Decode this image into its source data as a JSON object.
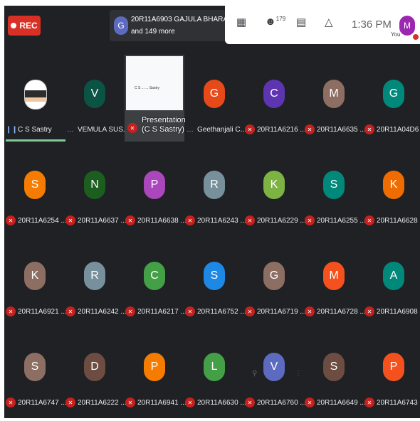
{
  "recording": {
    "label": "REC"
  },
  "presenter_chip": {
    "avatar": "G",
    "line1": "20R11A6903 GAJULA BHARAD...",
    "line2": "and 149 more"
  },
  "controls": {
    "participants_count": "179",
    "time": "1:36 PM",
    "self_avatar": "M",
    "self_label": "You"
  },
  "presentation": {
    "label_line1": "Presentation",
    "label_line2": "(C S Sastry)",
    "slide_text": "C S ...  ... Sastry"
  },
  "tiles": [
    {
      "initial": "",
      "name": "C S Sastry",
      "color": "#ffffff",
      "state": "speaking",
      "photo": true
    },
    {
      "initial": "V",
      "name": "VEMULA SUS...",
      "color": "#0b5345",
      "state": "dots"
    },
    {
      "initial": "G",
      "name": "Geethanjali C...",
      "color": "#e64a19",
      "state": "dots"
    },
    {
      "initial": "C",
      "name": "20R11A6216 ...",
      "color": "#5e35b1",
      "state": "muted"
    },
    {
      "initial": "M",
      "name": "20R11A6635 ...",
      "color": "#8d6e63",
      "state": "muted"
    },
    {
      "initial": "G",
      "name": "20R11A04D6 ...",
      "color": "#00897b",
      "state": "muted"
    },
    {
      "initial": "S",
      "name": "20R11A6254 ...",
      "color": "#f57c00",
      "state": "muted"
    },
    {
      "initial": "N",
      "name": "20R11A6637 ...",
      "color": "#1b5e20",
      "state": "muted"
    },
    {
      "initial": "P",
      "name": "20R11A6638 ...",
      "color": "#ab47bc",
      "state": "muted"
    },
    {
      "initial": "R",
      "name": "20R11A6243 ...",
      "color": "#78909c",
      "state": "muted"
    },
    {
      "initial": "K",
      "name": "20R11A6229 ...",
      "color": "#7cb342",
      "state": "muted"
    },
    {
      "initial": "S",
      "name": "20R11A6255 ...",
      "color": "#00897b",
      "state": "muted"
    },
    {
      "initial": "K",
      "name": "20R11A6628 ...",
      "color": "#ef6c00",
      "state": "muted"
    },
    {
      "initial": "K",
      "name": "20R11A6921 ...",
      "color": "#8d6e63",
      "state": "muted"
    },
    {
      "initial": "R",
      "name": "20R11A6242 ...",
      "color": "#78909c",
      "state": "muted"
    },
    {
      "initial": "C",
      "name": "20R11A6217 ...",
      "color": "#43a047",
      "state": "muted"
    },
    {
      "initial": "S",
      "name": "20R11A6752 ...",
      "color": "#1e88e5",
      "state": "muted"
    },
    {
      "initial": "G",
      "name": "20R11A6719 ...",
      "color": "#8d6e63",
      "state": "muted"
    },
    {
      "initial": "M",
      "name": "20R11A6728 ...",
      "color": "#f4511e",
      "state": "muted"
    },
    {
      "initial": "A",
      "name": "20R11A6908 ...",
      "color": "#00897b",
      "state": "muted"
    },
    {
      "initial": "S",
      "name": "20R11A6747 ...",
      "color": "#8d6e63",
      "state": "muted"
    },
    {
      "initial": "D",
      "name": "20R11A6222 ...",
      "color": "#6d4c41",
      "state": "muted"
    },
    {
      "initial": "P",
      "name": "20R11A6941 ...",
      "color": "#f57c00",
      "state": "muted"
    },
    {
      "initial": "L",
      "name": "20R11A6630 ...",
      "color": "#43a047",
      "state": "muted"
    },
    {
      "initial": "V",
      "name": "20R11A6760 ...",
      "color": "#5c6bc0",
      "state": "muted"
    },
    {
      "initial": "S",
      "name": "20R11A6649 ...",
      "color": "#6d4c41",
      "state": "muted"
    },
    {
      "initial": "P",
      "name": "20R11A6743 ...",
      "color": "#f4511e",
      "state": "muted"
    }
  ],
  "colors": {
    "background": "#202124",
    "muted": "#c5221f",
    "speaking": "#81c995",
    "rec": "#d93025"
  }
}
